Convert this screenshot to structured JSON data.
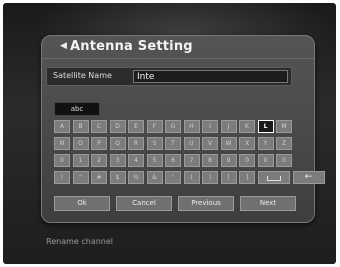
{
  "dialog": {
    "title": "Antenna Setting"
  },
  "satellite": {
    "label": "Satellite Name",
    "value": "Inte"
  },
  "keyboard": {
    "mode": "abc",
    "focused_key": "L",
    "rows": [
      [
        "A",
        "B",
        "C",
        "D",
        "E",
        "F",
        "G",
        "H",
        "I",
        "J",
        "K",
        "L",
        "M"
      ],
      [
        "N",
        "O",
        "P",
        "Q",
        "R",
        "S",
        "T",
        "U",
        "V",
        "W",
        "X",
        "Y",
        "Z"
      ],
      [
        "0",
        "1",
        "2",
        "3",
        "4",
        "5",
        "6",
        "7",
        "8",
        "9",
        "0",
        "0",
        "0"
      ],
      [
        "!",
        "\"",
        "#",
        "$",
        "%",
        "&",
        "'",
        "(",
        ")",
        "[",
        "]"
      ]
    ],
    "space_icon": "space-key-icon",
    "backspace_icon": "backspace-arrow-icon"
  },
  "buttons": {
    "ok": "Ok",
    "cancel": "Cancel",
    "previous": "Previous",
    "next": "Next"
  },
  "status": {
    "text": "Rename channel"
  }
}
